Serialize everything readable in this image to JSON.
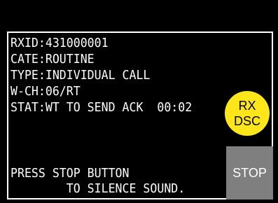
{
  "info_lines": {
    "rxid": "RXID:431000001",
    "cate": "CATE:ROUTINE",
    "type": "TYPE:INDIVIDUAL CALL",
    "wch": "W-CH:06/RT",
    "stat": "STAT:WT TO SEND ACK  00:02"
  },
  "rx_dsc_button": {
    "line1": "RX",
    "line2": "DSC",
    "color": "#ffe61a"
  },
  "message": {
    "line1": "PRESS STOP BUTTON",
    "line2": "        TO SILENCE SOUND."
  },
  "stop_button": {
    "label": "STOP",
    "color": "#7f7f7f"
  }
}
